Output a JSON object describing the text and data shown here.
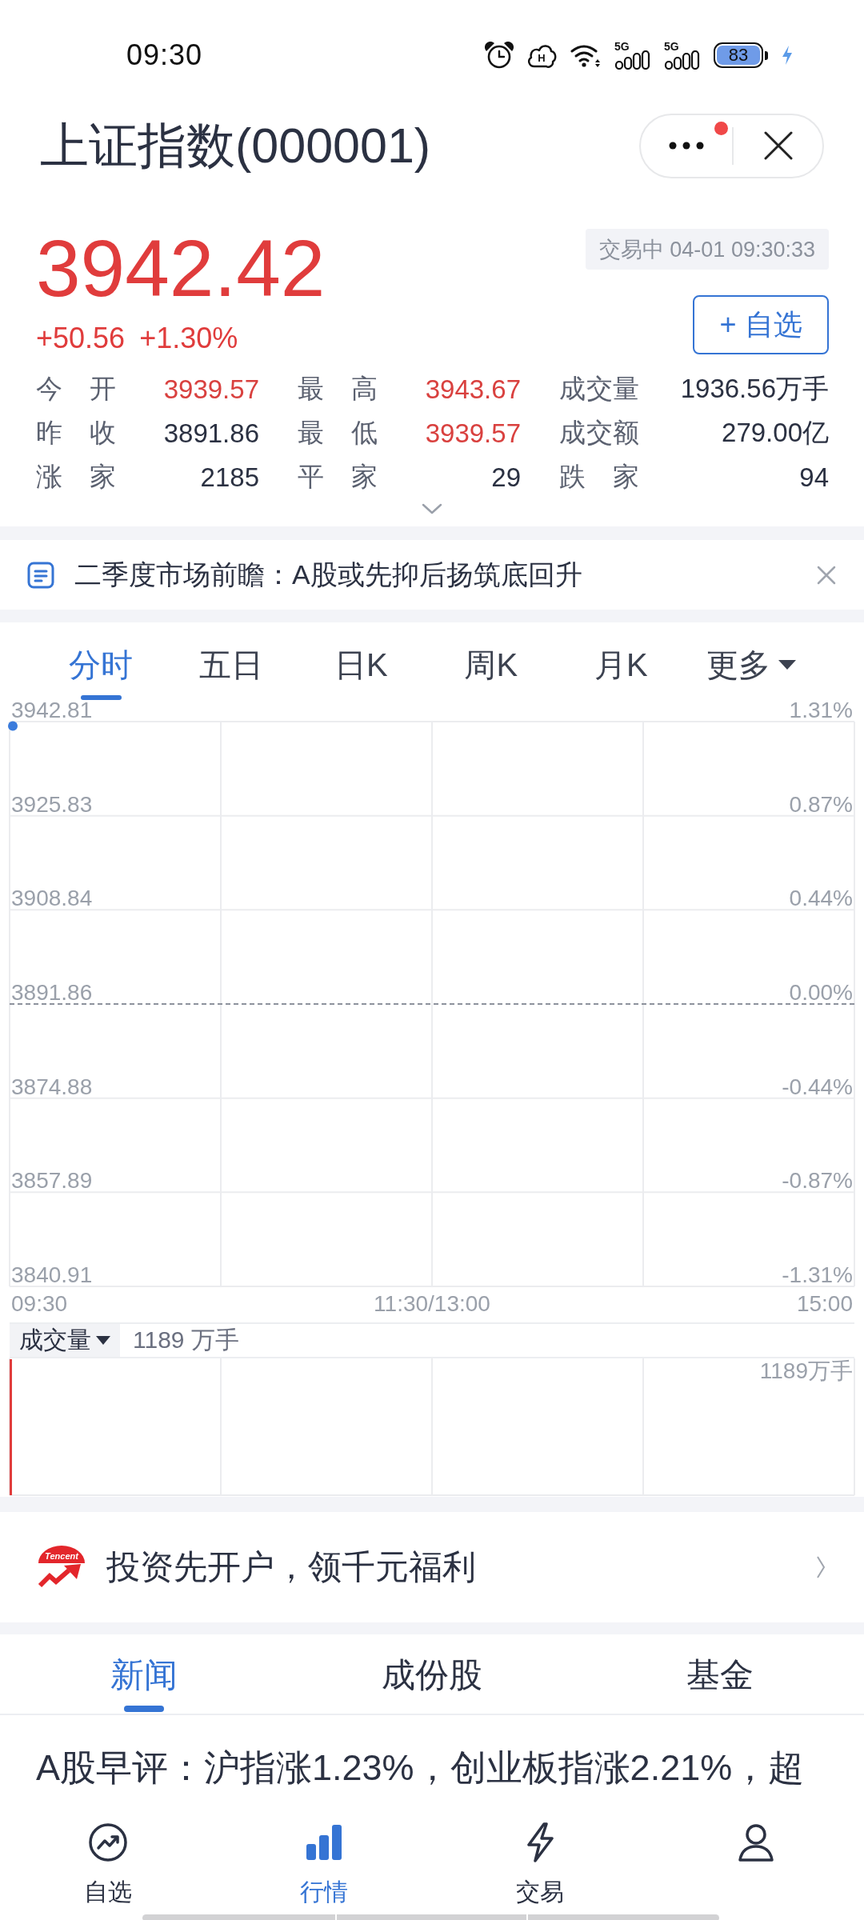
{
  "status_bar": {
    "time": "09:30",
    "hd_badge": "H",
    "network_labels": [
      "5G",
      "5G"
    ],
    "battery": "83"
  },
  "header": {
    "title": "上证指数(000001)",
    "menu_badge": true
  },
  "quote": {
    "price": "3942.42",
    "change": "+50.56",
    "change_percent": "+1.30%",
    "status": "交易中 04-01 09:30:33",
    "watchlist_button": "+ 自选"
  },
  "stats": [
    {
      "label": "今 开",
      "value": "3939.57",
      "color": "#d9413f"
    },
    {
      "label": "最 高",
      "value": "3943.67",
      "color": "#d9413f"
    },
    {
      "label": "成交量",
      "value": "1936.56万手",
      "color": "#2b3142"
    },
    {
      "label": "昨 收",
      "value": "3891.86",
      "color": "#2b3142"
    },
    {
      "label": "最 低",
      "value": "3939.57",
      "color": "#d9413f"
    },
    {
      "label": "成交额",
      "value": "279.00亿",
      "color": "#2b3142"
    },
    {
      "label": "涨 家",
      "value": "2185",
      "color": "#2b3142"
    },
    {
      "label": "平 家",
      "value": "29",
      "color": "#2b3142"
    },
    {
      "label": "跌 家",
      "value": "94",
      "color": "#2b3142"
    }
  ],
  "notice": {
    "text": "二季度市场前瞻：A股或先抑后扬筑底回升"
  },
  "chart": {
    "tabs": [
      {
        "label": "分时",
        "kind": "tab",
        "selected": true
      },
      {
        "label": "五日",
        "kind": "tab",
        "selected": false
      },
      {
        "label": "日K",
        "kind": "tab",
        "selected": false
      },
      {
        "label": "周K",
        "kind": "tab",
        "selected": false
      },
      {
        "label": "月K",
        "kind": "tab",
        "selected": false
      },
      {
        "label": "更多",
        "kind": "dropdown",
        "selected": false
      }
    ],
    "chart_data": {
      "type": "line",
      "categories": [
        "09:30",
        "11:30/13:00",
        "15:00"
      ],
      "values": [
        3942,
        null,
        null
      ],
      "ylim": [
        3840.91,
        3942.81
      ],
      "yticks": [
        3942.81,
        3925.83,
        3908.84,
        3891.86,
        3874.88,
        3857.89,
        3840.91
      ],
      "grid": true,
      "marker": true
    },
    "percent_ticks": [
      "1.31%",
      "0.87%",
      "0.44%",
      "0.00%",
      "-0.44%",
      "-0.87%",
      "-1.31%"
    ]
  },
  "volume": {
    "selector": "成交量",
    "reading": "1189 万手",
    "scale_label": "1189万手"
  },
  "promo": {
    "logo_text": "Tencent",
    "text": "投资先开户，领千元福利"
  },
  "news": {
    "tabs": [
      {
        "label": "新闻",
        "selected": true
      },
      {
        "label": "成份股",
        "selected": false
      },
      {
        "label": "基金",
        "selected": false
      }
    ],
    "headline": "A股早评：沪指涨1.23%，创业板指涨2.21%，超"
  },
  "bottom_nav": [
    {
      "kind": "watchlist",
      "label": "自选",
      "selected": false
    },
    {
      "kind": "market",
      "label": "行情",
      "selected": true
    },
    {
      "kind": "trade",
      "label": "交易",
      "selected": false
    },
    {
      "kind": "profile",
      "selected": false
    }
  ]
}
